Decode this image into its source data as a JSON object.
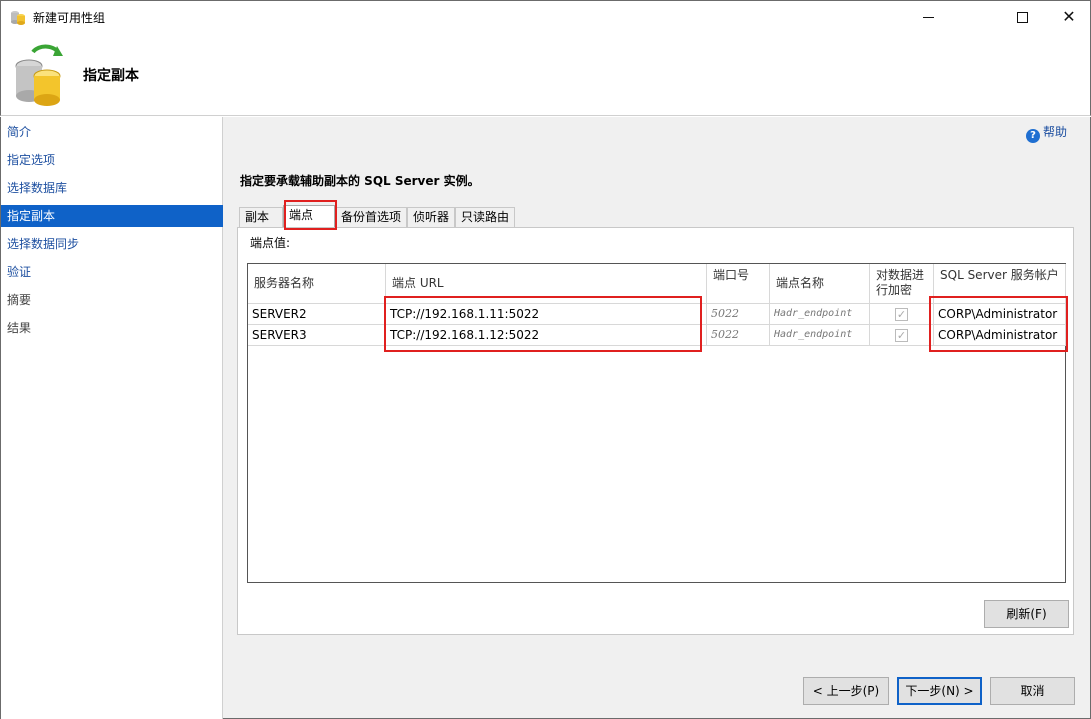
{
  "window": {
    "title": "新建可用性组",
    "minimize_label": "—",
    "maximize_label": "□",
    "close_label": "✕"
  },
  "header": {
    "title": "指定副本"
  },
  "sidebar": {
    "items": [
      {
        "label": "简介",
        "state": "link"
      },
      {
        "label": "指定选项",
        "state": "link"
      },
      {
        "label": "选择数据库",
        "state": "link"
      },
      {
        "label": "指定副本",
        "state": "active"
      },
      {
        "label": "选择数据同步",
        "state": "link"
      },
      {
        "label": "验证",
        "state": "link"
      },
      {
        "label": "摘要",
        "state": "disabled"
      },
      {
        "label": "结果",
        "state": "disabled"
      }
    ]
  },
  "main": {
    "help_label": "帮助",
    "instruction": "指定要承载辅助副本的 SQL Server 实例。",
    "tabs": [
      {
        "label": "副本"
      },
      {
        "label": "端点"
      },
      {
        "label": "备份首选项"
      },
      {
        "label": "侦听器"
      },
      {
        "label": "只读路由"
      }
    ],
    "active_tab": "端点",
    "panel_label": "端点值:",
    "grid": {
      "columns": [
        "服务器名称",
        "端点 URL",
        "端口号",
        "端点名称",
        "对数据进行加密",
        "SQL Server 服务帐户"
      ],
      "rows": [
        {
          "server": "SERVER2",
          "url": "TCP://192.168.1.11:5022",
          "port": "5022",
          "endpoint": "Hadr_endpoint",
          "encrypt": true,
          "account": "CORP\\Administrator"
        },
        {
          "server": "SERVER3",
          "url": "TCP://192.168.1.12:5022",
          "port": "5022",
          "endpoint": "Hadr_endpoint",
          "encrypt": true,
          "account": "CORP\\Administrator"
        }
      ]
    },
    "refresh_label": "刷新(F)"
  },
  "footer": {
    "back_label": "< 上一步(P)",
    "next_label": "下一步(N) >",
    "cancel_label": "取消"
  },
  "colors": {
    "accent": "#0f62c8",
    "highlight": "#e0201f"
  }
}
